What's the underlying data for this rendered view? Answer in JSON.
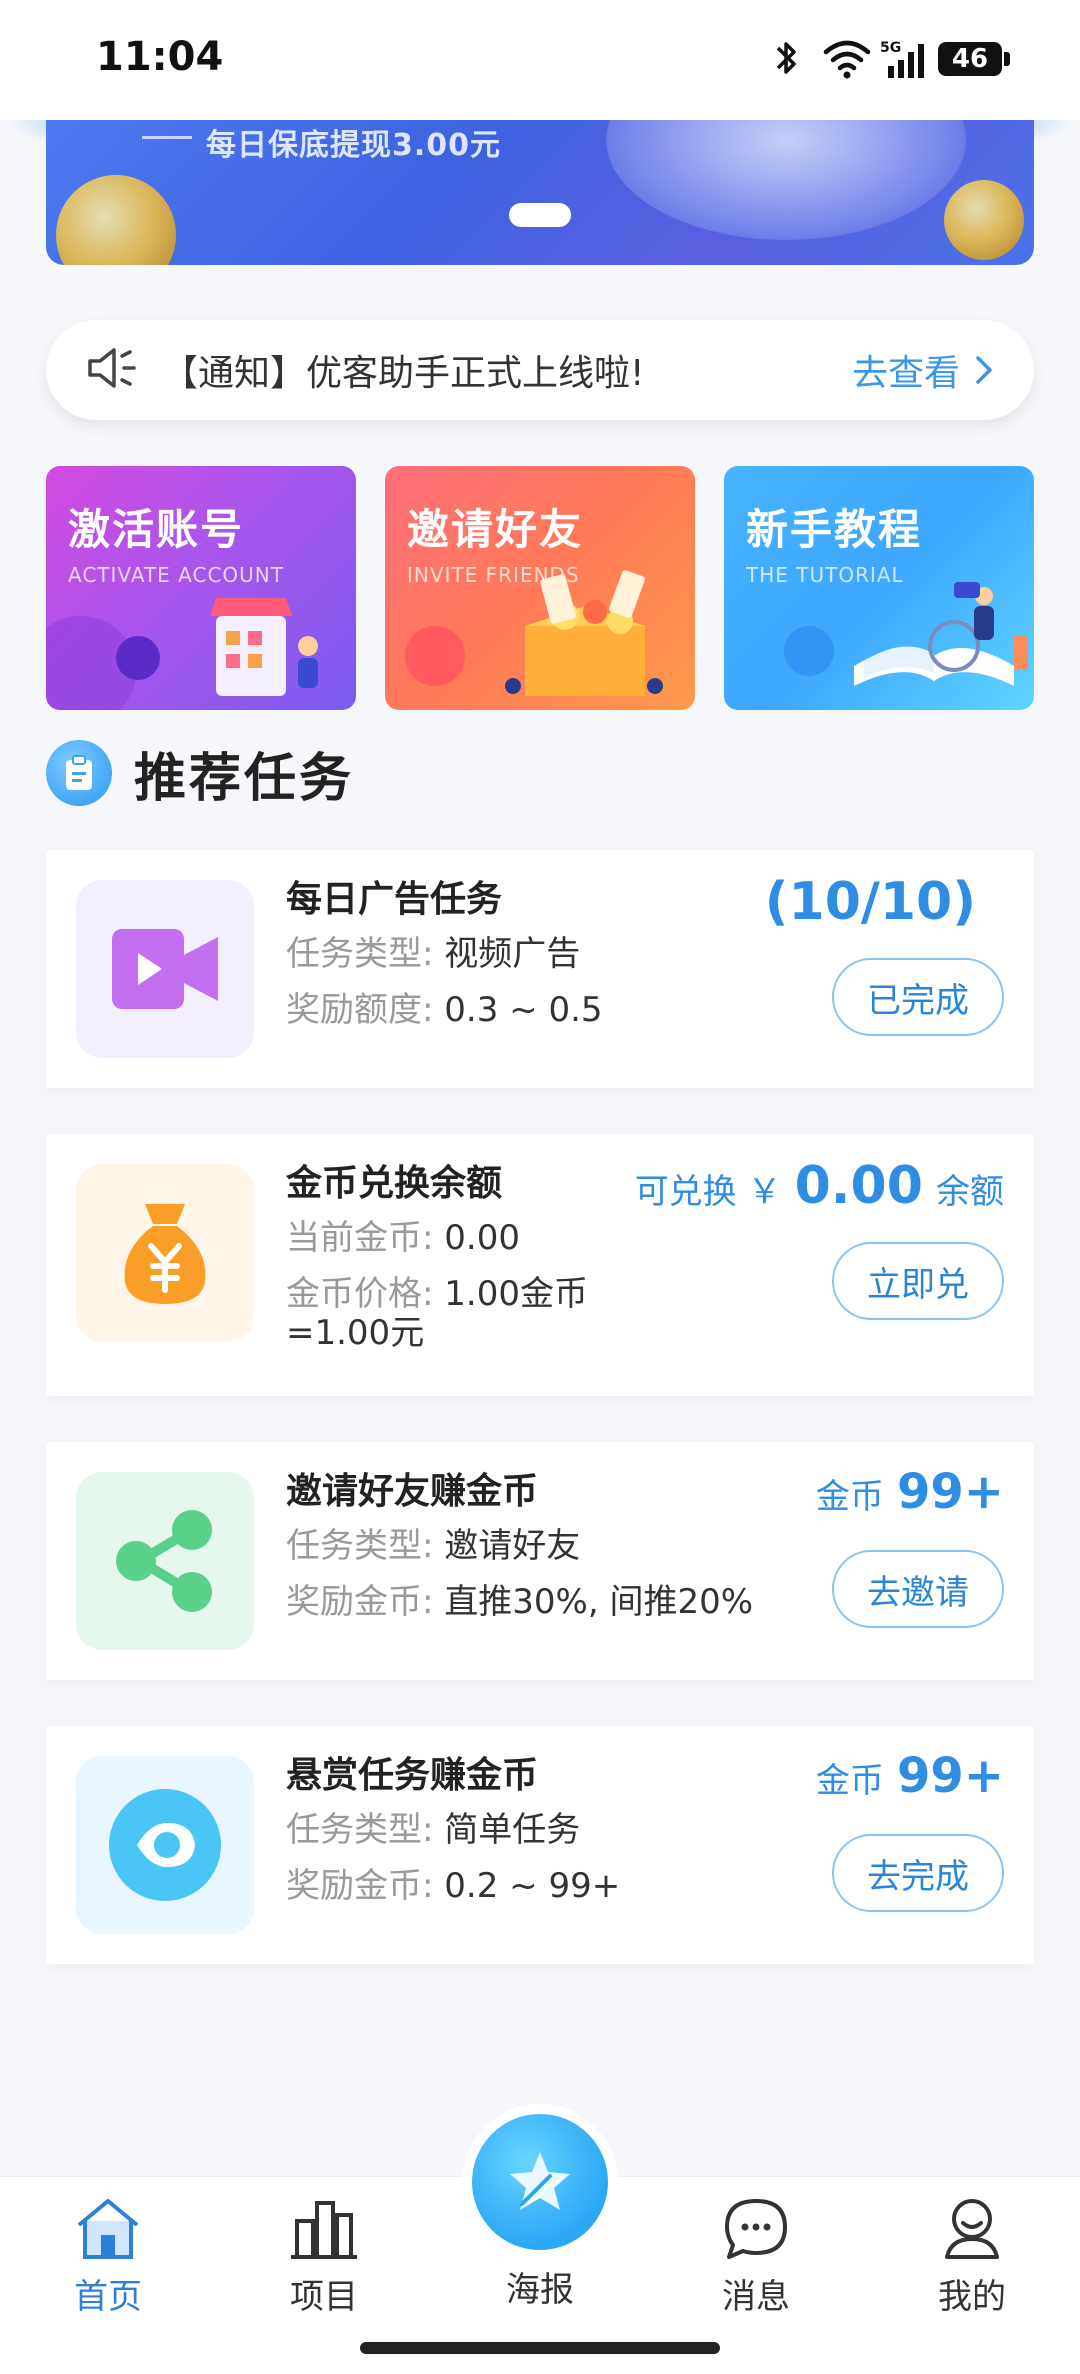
{
  "status_bar": {
    "time": "11:04",
    "battery": "46",
    "network": "5G"
  },
  "banner": {
    "text": "每日保底提现3.00元"
  },
  "notice": {
    "text": "【通知】优客助手正式上线啦!",
    "link": "去查看"
  },
  "quick_cards": [
    {
      "title": "激活账号",
      "subtitle": "ACTIVATE ACCOUNT"
    },
    {
      "title": "邀请好友",
      "subtitle": "INVITE FRIENDS"
    },
    {
      "title": "新手教程",
      "subtitle": "THE TUTORIAL"
    }
  ],
  "section": {
    "title": "推荐任务"
  },
  "tasks": [
    {
      "title": "每日广告任务",
      "line1_label": "任务类型:",
      "line1_value": "视频广告",
      "line2_label": "奖励额度:",
      "line2_value": "0.3 ~ 0.5",
      "progress": "(10/10)",
      "button": "已完成"
    },
    {
      "title": "金币兑换余额",
      "line1_label": "当前金币:",
      "line1_value": "0.00",
      "line2_label": "金币价格:",
      "line2_value": "1.00金币",
      "line3": "=1.00元",
      "pre": "可兑换 ￥",
      "amount": "0.00",
      "post": "余额",
      "button": "立即兑"
    },
    {
      "title": "邀请好友赚金币",
      "line1_label": "任务类型:",
      "line1_value": "邀请好友",
      "line2_label": "奖励金币:",
      "line2_value": "直推30%, 间推20%",
      "coin_label": "金币",
      "coin_value": "99+",
      "button": "去邀请"
    },
    {
      "title": "悬赏任务赚金币",
      "line1_label": "任务类型:",
      "line1_value": "简单任务",
      "line2_label": "奖励金币:",
      "line2_value": "0.2 ~ 99+",
      "coin_label": "金币",
      "coin_value": "99+",
      "button": "去完成"
    }
  ],
  "nav": {
    "home": "首页",
    "projects": "项目",
    "poster": "海报",
    "messages": "消息",
    "mine": "我的"
  },
  "colors": {
    "accent": "#2f8de4",
    "nav_active": "#2d7fd8"
  }
}
